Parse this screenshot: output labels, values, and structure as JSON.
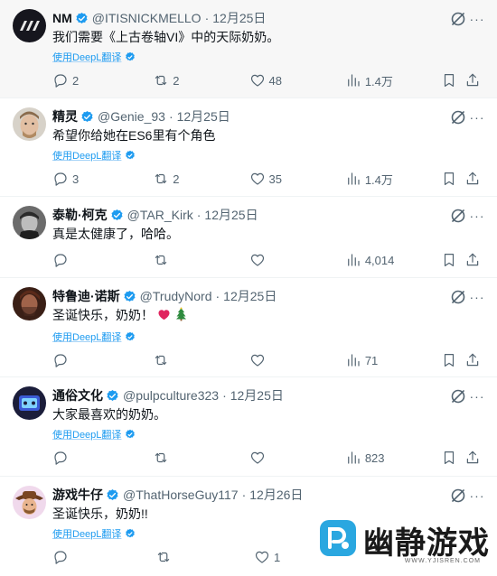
{
  "translate_label": "使用DeepL翻译",
  "posts": [
    {
      "name": "NM",
      "handle": "@ITISNICKMELLO",
      "date": "12月25日",
      "text": "我们需要《上古卷轴VI》中的天际奶奶。",
      "replies": "2",
      "reposts": "2",
      "likes": "48",
      "views": "1.4万",
      "avatar_kind": "logo"
    },
    {
      "name": "精灵",
      "handle": "@Genie_93",
      "date": "12月25日",
      "text": "希望你给她在ES6里有个角色",
      "replies": "3",
      "reposts": "2",
      "likes": "35",
      "views": "1.4万",
      "avatar_kind": "face-light"
    },
    {
      "name": "泰勒·柯克",
      "handle": "@TAR_Kirk",
      "date": "12月25日",
      "text": "真是太健康了，哈哈。",
      "replies": "",
      "reposts": "",
      "likes": "",
      "views": "4,014",
      "avatar_kind": "face-bw"
    },
    {
      "name": "特鲁迪·诺斯",
      "handle": "@TrudyNord",
      "date": "12月25日",
      "text": "圣诞快乐，奶奶！",
      "replies": "",
      "reposts": "",
      "likes": "",
      "views": "71",
      "avatar_kind": "face-dark"
    },
    {
      "name": "通俗文化",
      "handle": "@pulpculture323",
      "date": "12月25日",
      "text": "大家最喜欢的奶奶。",
      "replies": "",
      "reposts": "",
      "likes": "",
      "views": "823",
      "avatar_kind": "game"
    },
    {
      "name": "游戏牛仔",
      "handle": "@ThatHorseGuy117",
      "date": "12月26日",
      "text": "圣诞快乐，奶奶!!",
      "replies": "",
      "reposts": "",
      "likes": "1",
      "views": "",
      "avatar_kind": "cowboy"
    }
  ],
  "watermark": {
    "text": "幽静游戏",
    "url": "WWW.YJISREN.COM"
  },
  "colors": {
    "accent": "#1d9bf0",
    "secondary_text": "#536471",
    "divider": "#eff3f4"
  }
}
